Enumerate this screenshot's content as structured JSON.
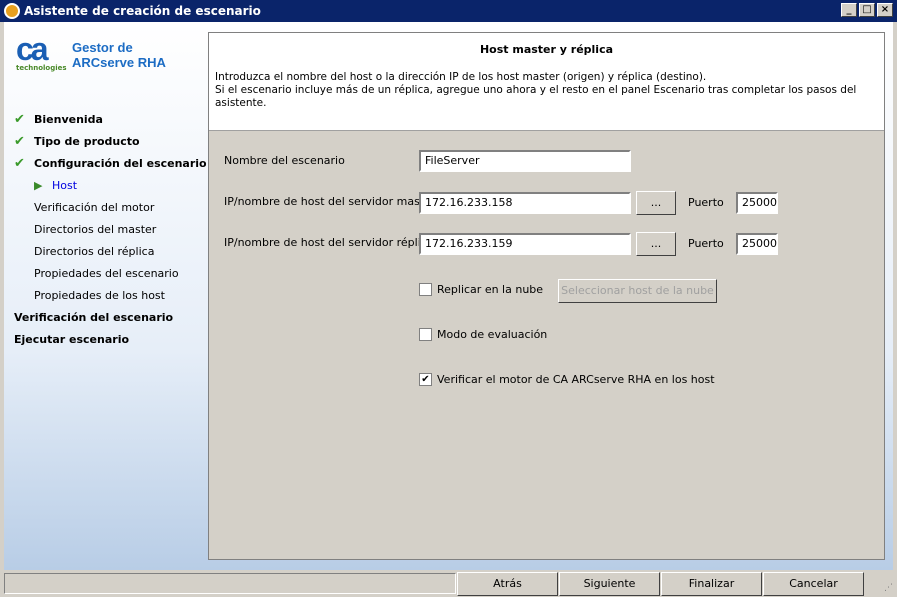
{
  "window": {
    "title": "Asistente de creación de escenario"
  },
  "logo": {
    "brand": "ca",
    "sub": "technologies"
  },
  "product": {
    "line1": "Gestor de",
    "line2": "ARCserve RHA"
  },
  "nav": [
    {
      "label": "Bienvenida",
      "state": "done"
    },
    {
      "label": "Tipo de producto",
      "state": "done"
    },
    {
      "label": "Configuración del escenario",
      "state": "done"
    },
    {
      "label": "Host",
      "state": "current"
    },
    {
      "label": "Verificación del motor",
      "state": "pending"
    },
    {
      "label": "Directorios del master",
      "state": "pending"
    },
    {
      "label": "Directorios del réplica",
      "state": "pending"
    },
    {
      "label": "Propiedades del escenario",
      "state": "pending"
    },
    {
      "label": "Propiedades de los host",
      "state": "pending"
    },
    {
      "label": "Verificación del escenario",
      "state": "pending"
    },
    {
      "label": "Ejecutar escenario",
      "state": "pending"
    }
  ],
  "header": {
    "title": "Host master y réplica",
    "line1": "Introduzca el nombre del host o la dirección IP de los host master (origen) y réplica (destino).",
    "line2": "Si el escenario incluye más de un réplica, agregue uno ahora y el resto en el panel Escenario tras completar los pasos del asistente."
  },
  "form": {
    "scenario_label": "Nombre del escenario",
    "scenario_value": "FileServer",
    "master_label": "IP/nombre de host del servidor master",
    "master_value": "172.16.233.158",
    "replica_label": "IP/nombre de host del servidor réplica",
    "replica_value": "172.16.233.159",
    "browse": "...",
    "port_label": "Puerto",
    "master_port": "25000",
    "replica_port": "25000",
    "cloud_label": "Replicar en la nube",
    "cloud_checked": false,
    "cloud_button": "Seleccionar host de la nube",
    "eval_label": "Modo de evaluación",
    "eval_checked": false,
    "verify_label": "Verificar el motor de CA ARCserve RHA en los host",
    "verify_checked": true
  },
  "footer": {
    "back": "Atrás",
    "next": "Siguiente",
    "finish": "Finalizar",
    "cancel": "Cancelar"
  }
}
